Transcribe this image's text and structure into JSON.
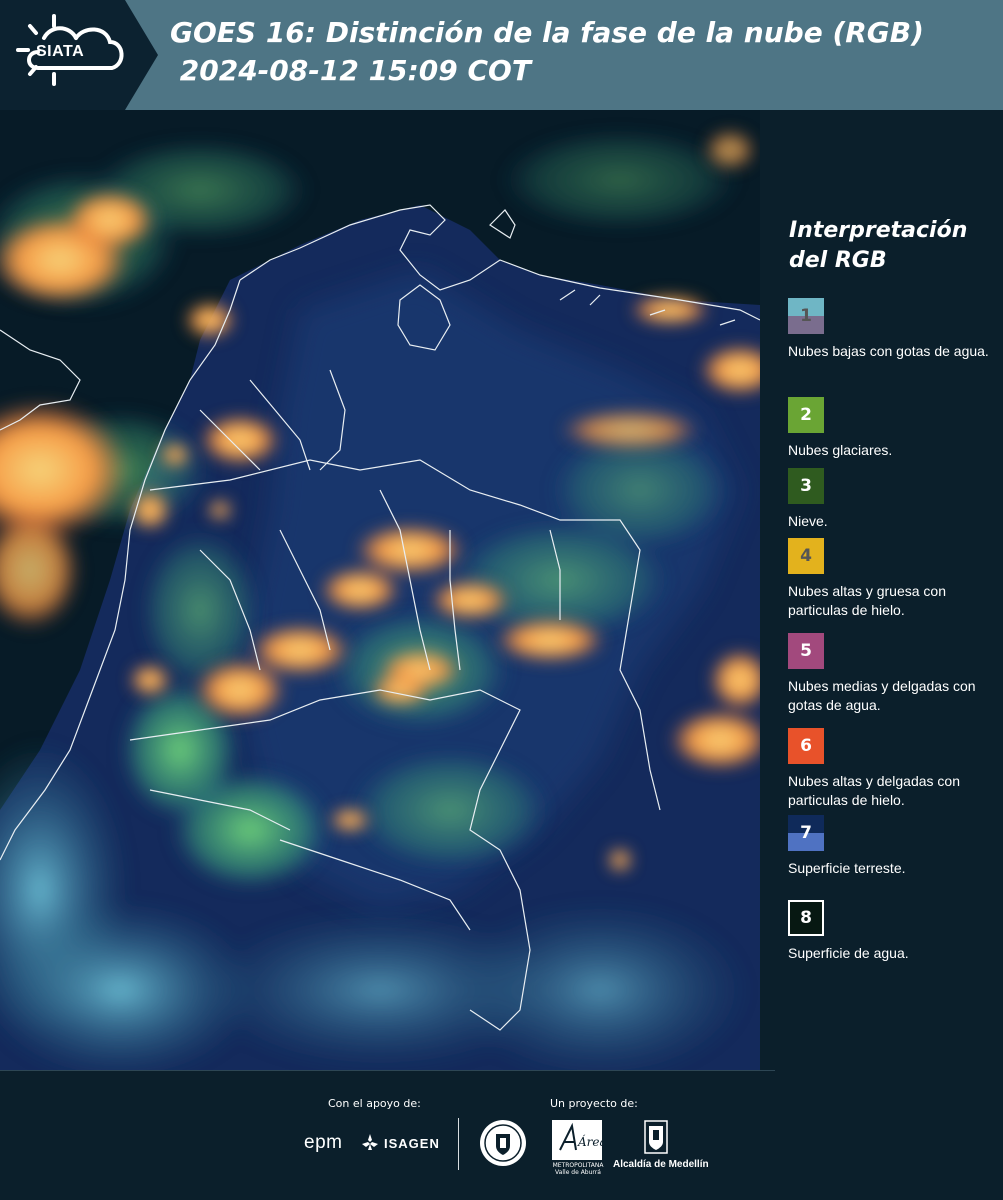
{
  "header": {
    "logo_text": "SIATA",
    "title_line1": "GOES 16: Distinción de la fase de la nube (RGB)",
    "title_line2": " 2024-08-12 15:09 COT"
  },
  "legend": {
    "title_line1": "Interpretación",
    "title_line2": "del RGB",
    "items": [
      {
        "number": "1",
        "label": "Nubes bajas con gotas de agua.",
        "color_top": "#6fb6c5",
        "color_bottom": "#7a6d8e",
        "text_color": "#555555"
      },
      {
        "number": "2",
        "label": "Nubes glaciares.",
        "color_top": "#6aa534",
        "color_bottom": "#6aa534",
        "text_color": "#ffffff"
      },
      {
        "number": "3",
        "label": "Nieve.",
        "color_top": "#2f5b1f",
        "color_bottom": "#2f5b1f",
        "text_color": "#ffffff"
      },
      {
        "number": "4",
        "label": "Nubes altas y gruesa con particulas de hielo.",
        "color_top": "#e3b21d",
        "color_bottom": "#e3b21d",
        "text_color": "#555555"
      },
      {
        "number": "5",
        "label": "Nubes medias y delgadas con gotas de agua.",
        "color_top": "#a2497d",
        "color_bottom": "#a2497d",
        "text_color": "#ffffff"
      },
      {
        "number": "6",
        "label": "Nubes altas y delgadas con particulas de hielo.",
        "color_top": "#e8522a",
        "color_bottom": "#e8522a",
        "text_color": "#ffffff"
      },
      {
        "number": "7",
        "label": "Superficie terreste.",
        "color_top": "#0f2a5a",
        "color_bottom": "#4f72c2",
        "text_color": "#ffffff"
      },
      {
        "number": "8",
        "label": "Superficie de agua.",
        "color_top": "#071812",
        "color_bottom": "#071812",
        "text_color": "#ffffff"
      }
    ]
  },
  "footer": {
    "support_label": "Con el apoyo de:",
    "project_label": "Un proyecto de:",
    "epm": "epm",
    "isagen": "ISAGEN",
    "area_caption": "METROPOLITANA Valle de Aburrá",
    "area_logo_text": "Área",
    "alcaldia": "Alcaldía de Medellín"
  },
  "colors": {
    "header_bg": "#4e7585",
    "panel_bg": "#0b1f2b",
    "cloud_orange": "#f7a040",
    "cloud_yellow": "#f5d060",
    "cloud_green": "#5fbf6a",
    "land_blue": "#14285a",
    "water": "#071b27"
  }
}
